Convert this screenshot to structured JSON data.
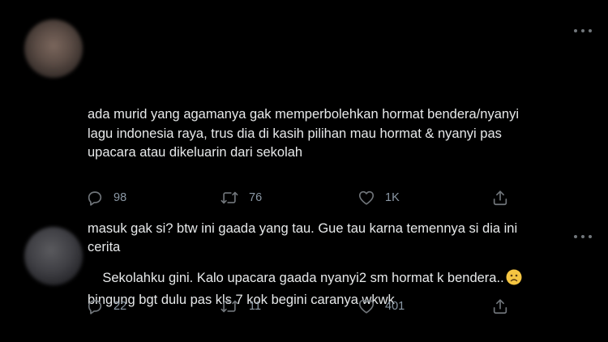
{
  "tweets": [
    {
      "paragraphs": [
        "ada murid yang agamanya gak memperbolehkan hormat bendera/nyanyi\nlagu indonesia raya, trus dia di kasih pilihan mau hormat & nyanyi pas\nupacara atau dikeluarin dari sekolah",
        "masuk gak si? btw ini gaada yang tau. Gue tau karna temennya si dia ini\ncerita"
      ],
      "replies": "98",
      "retweets": "76",
      "likes": "1K"
    },
    {
      "paragraphs": [
        "Sekolahku gini. Kalo upacara gaada nyanyi2 sm hormat k bendera.."
      ],
      "paragraph_tail": "bingung bgt dulu pas kls 7 kok begini caranya wkwk",
      "emoji": "frowning-face-emoji",
      "replies": "22",
      "retweets": "11",
      "likes": "401"
    }
  ],
  "icons": {
    "reply": "reply-icon",
    "retweet": "retweet-icon",
    "like": "heart-icon",
    "share": "share-icon",
    "more": "more-icon"
  },
  "colors": {
    "background": "#000000",
    "text": "#e7e9ea",
    "muted": "#71767b",
    "emoji": "#f5c542"
  }
}
